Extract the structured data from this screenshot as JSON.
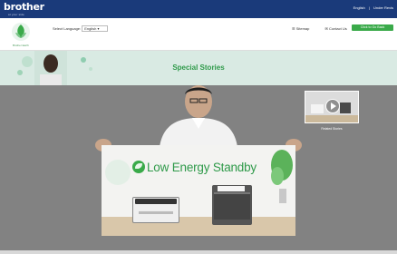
{
  "header": {
    "logo": "brother",
    "logo_tagline": "at your side",
    "top_links": [
      "English",
      "|",
      "Under Revis"
    ]
  },
  "subheader": {
    "eco_caption": "Brother Earth",
    "language_label": "Select Language",
    "language_value": "English",
    "utility": [
      "Sitemap",
      "Contact Us"
    ],
    "follow_button": "Click to Go Back"
  },
  "nav": {
    "items": [
      "News",
      "Our Goals",
      "Special Stories",
      "Environmental Views",
      "Environmental Products",
      "Brother Group Environmental Information"
    ],
    "active_index": 2
  },
  "banner": {
    "title": "Special Stories"
  },
  "video": {
    "panel_title": "Low Energy Standby",
    "thumbnail_caption": "Related Stories"
  },
  "colors": {
    "brand_blue": "#1a3a7a",
    "eco_green": "#3aaa4a",
    "banner_bg": "#d9eae3"
  }
}
